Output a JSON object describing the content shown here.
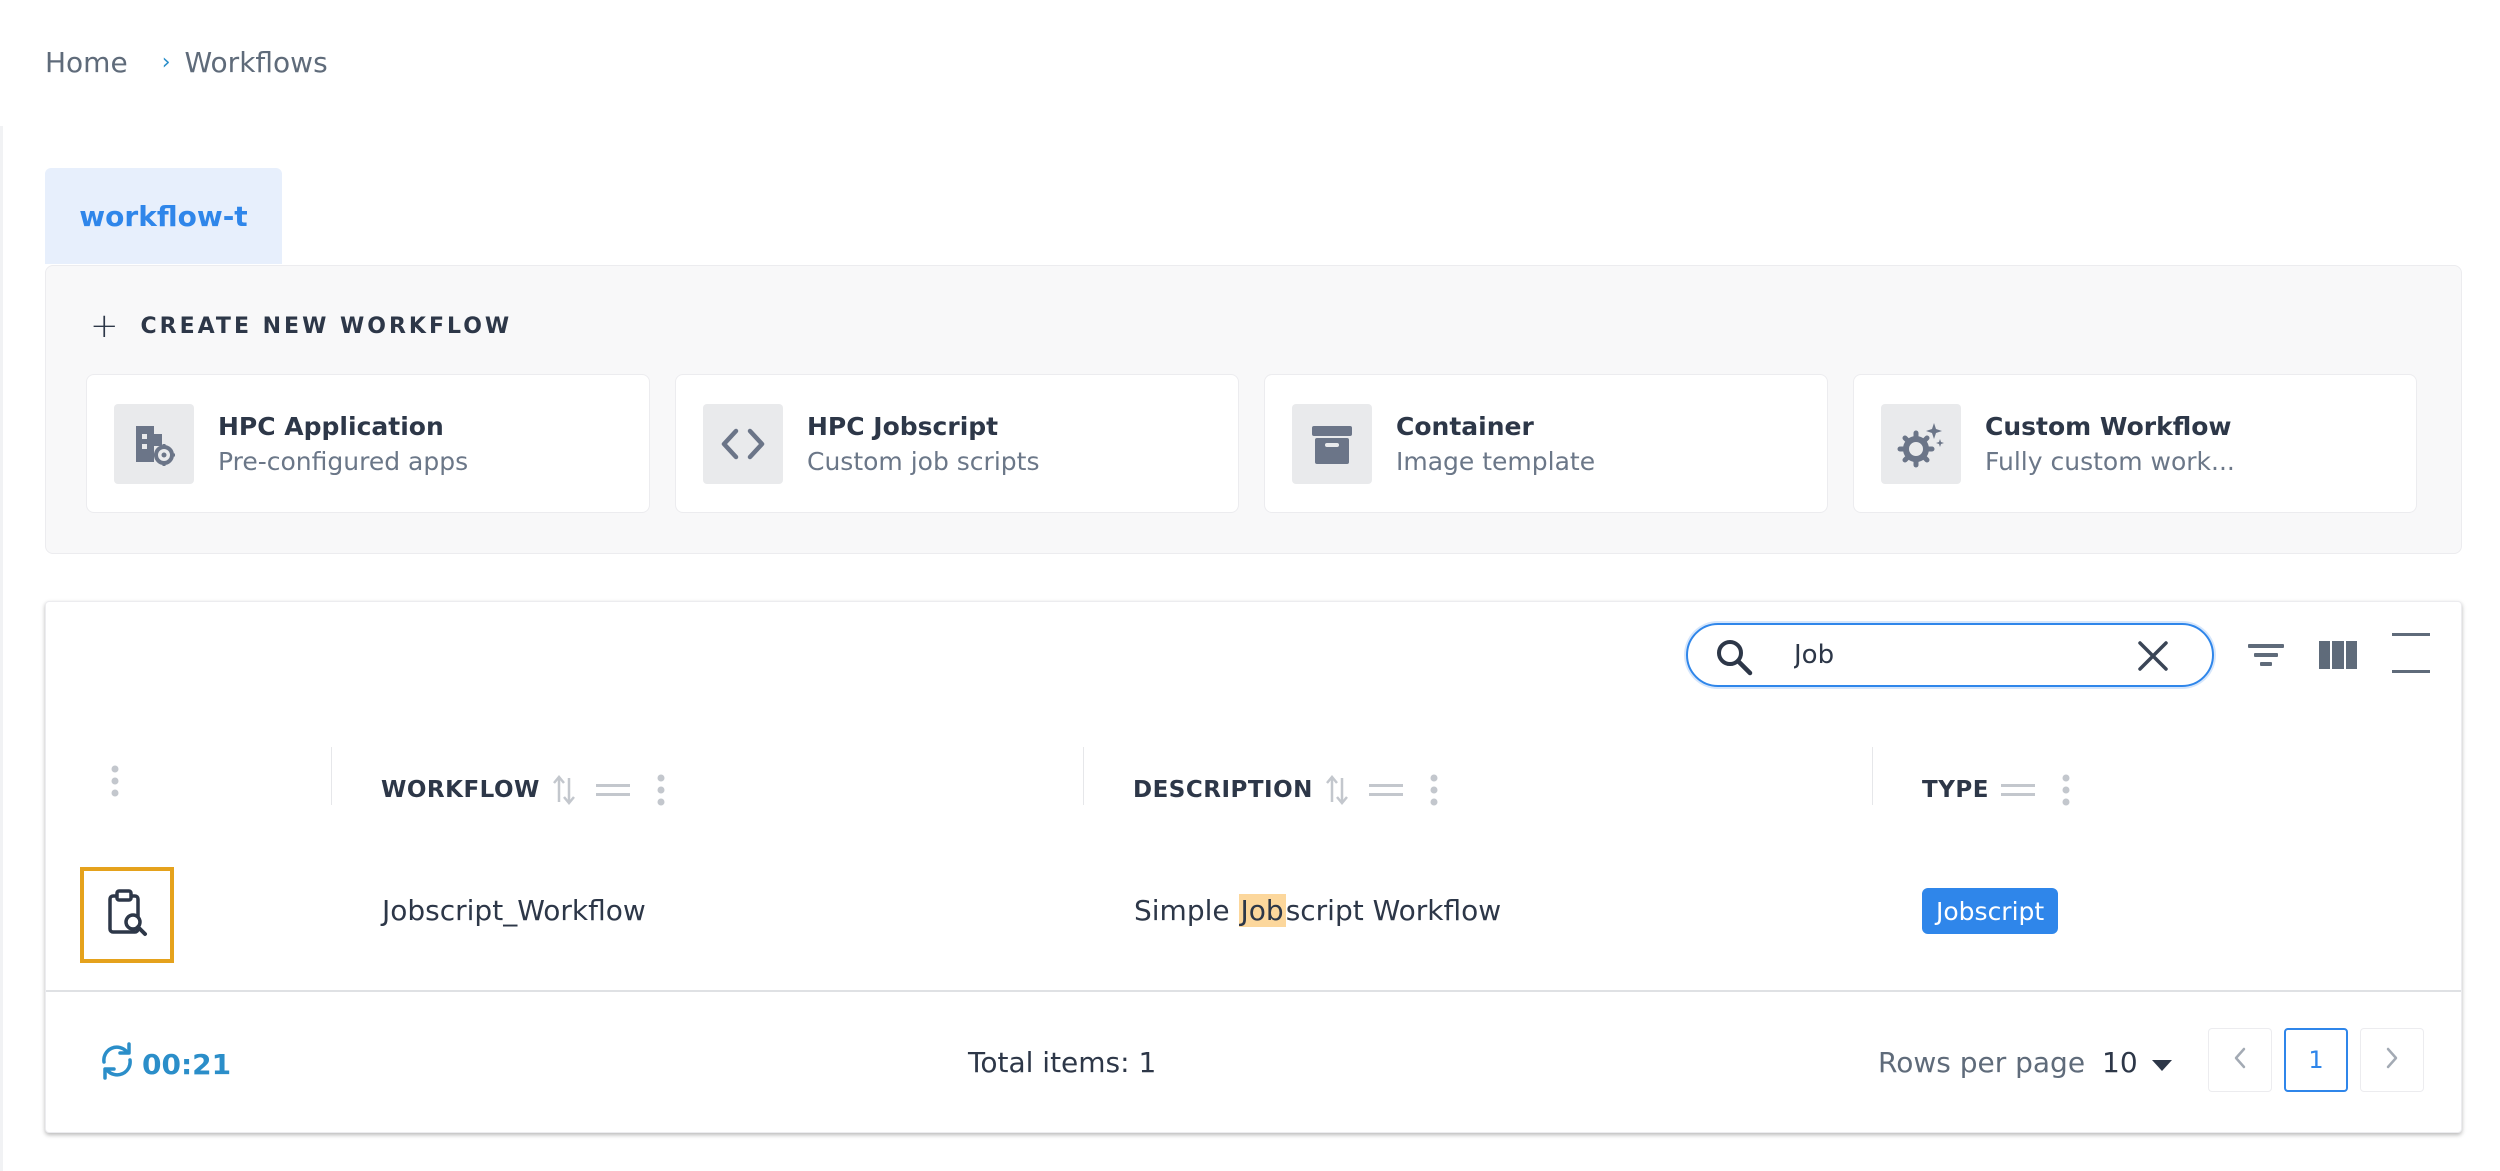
{
  "breadcrumb": {
    "home": "Home",
    "separator": "›",
    "current": "Workflows"
  },
  "tab": {
    "label": "workflow-t"
  },
  "create": {
    "label": "CREATE NEW WORKFLOW",
    "cards": [
      {
        "title": "HPC Application",
        "subtitle": "Pre-configured apps",
        "icon": "app-gear-icon"
      },
      {
        "title": "HPC Jobscript",
        "subtitle": "Custom job scripts",
        "icon": "code-icon"
      },
      {
        "title": "Container",
        "subtitle": "Image template",
        "icon": "archive-box-icon"
      },
      {
        "title": "Custom Workflow",
        "subtitle": "Fully custom work...",
        "icon": "gear-sparkle-icon"
      }
    ]
  },
  "search": {
    "value": "Job",
    "placeholder": ""
  },
  "table": {
    "columns": [
      {
        "label": "WORKFLOW"
      },
      {
        "label": "DESCRIPTION"
      },
      {
        "label": "TYPE"
      }
    ],
    "rows": [
      {
        "workflow": "Jobscript_Workflow",
        "description_before": "Simple ",
        "description_match": "Job",
        "description_after": "script Workflow",
        "type": "Jobscript"
      }
    ]
  },
  "footer": {
    "timer": "00:21",
    "total_items": "Total items: 1",
    "rows_per_page_label": "Rows per page",
    "rows_per_page": "10",
    "current_page": "1"
  },
  "colors": {
    "accent": "#2f86ea",
    "highlight": "#fcd79c",
    "selection_outline": "#e5a21c",
    "timer": "#2b8ec9"
  }
}
